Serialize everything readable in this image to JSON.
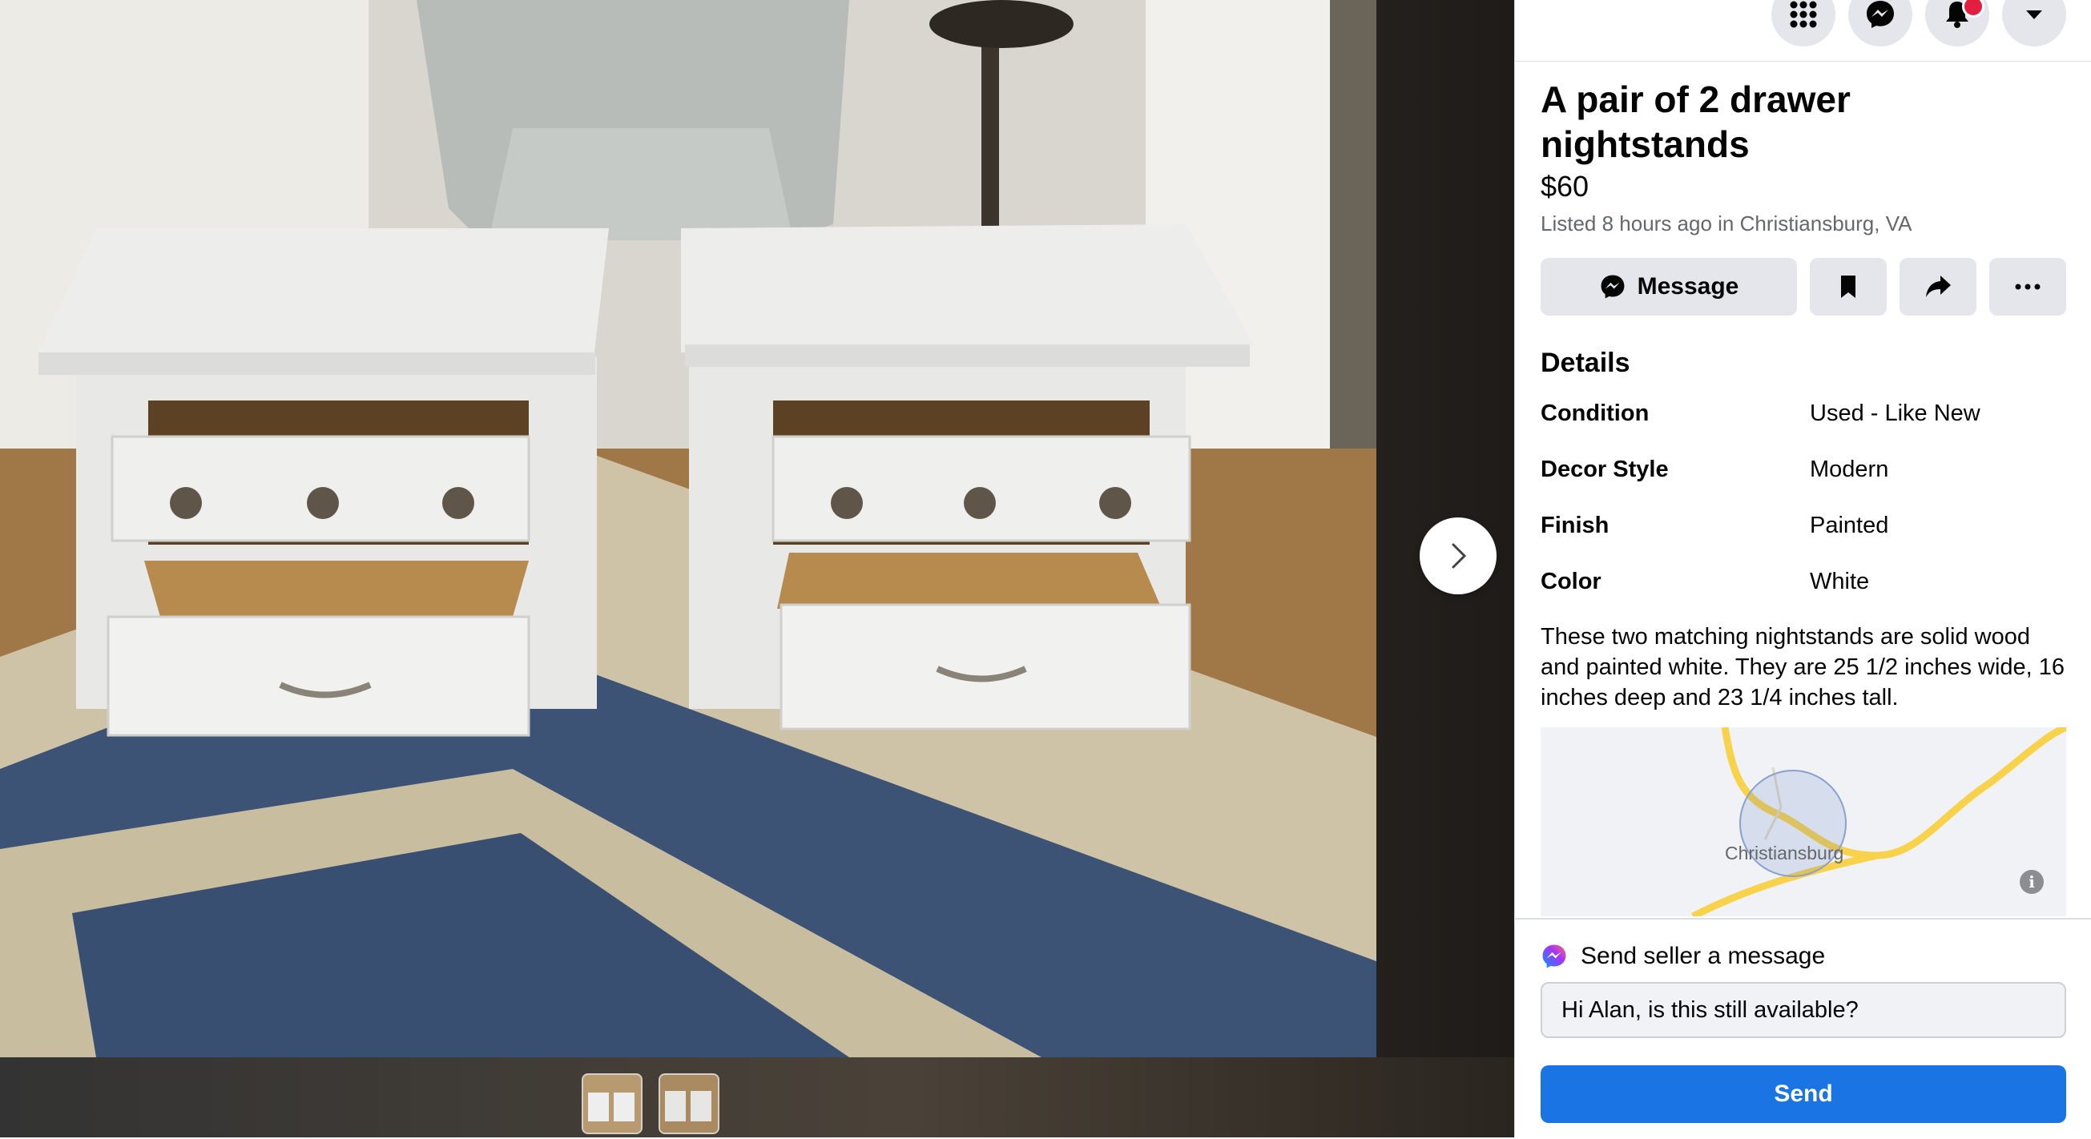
{
  "listing": {
    "title": "A pair of 2 drawer nightstands",
    "price": "$60",
    "meta": "Listed 8 hours ago in Christiansburg, VA"
  },
  "actions": {
    "message_label": "Message"
  },
  "details": {
    "heading": "Details",
    "rows": [
      {
        "label": "Condition",
        "value": "Used - Like New"
      },
      {
        "label": "Decor Style",
        "value": "Modern"
      },
      {
        "label": "Finish",
        "value": "Painted"
      },
      {
        "label": "Color",
        "value": "White"
      }
    ],
    "description": "These two matching nightstands are solid wood and painted white. They are 25 1/2 inches wide, 16 inches deep and 23 1/4 inches tall."
  },
  "map": {
    "location_label": "Christiansburg",
    "info_glyph": "i"
  },
  "send": {
    "header": "Send seller a message",
    "input_value": "Hi Alan, is this still available?",
    "button_label": "Send"
  },
  "nav_icons": [
    "menu-grid-icon",
    "messenger-icon",
    "notifications-bell-icon",
    "account-dropdown-icon"
  ],
  "colors": {
    "primary_button": "#1b74e4",
    "secondary_button": "#e4e6eb",
    "notification_badge": "#e41e3f",
    "map_road": "#f7d24a"
  }
}
